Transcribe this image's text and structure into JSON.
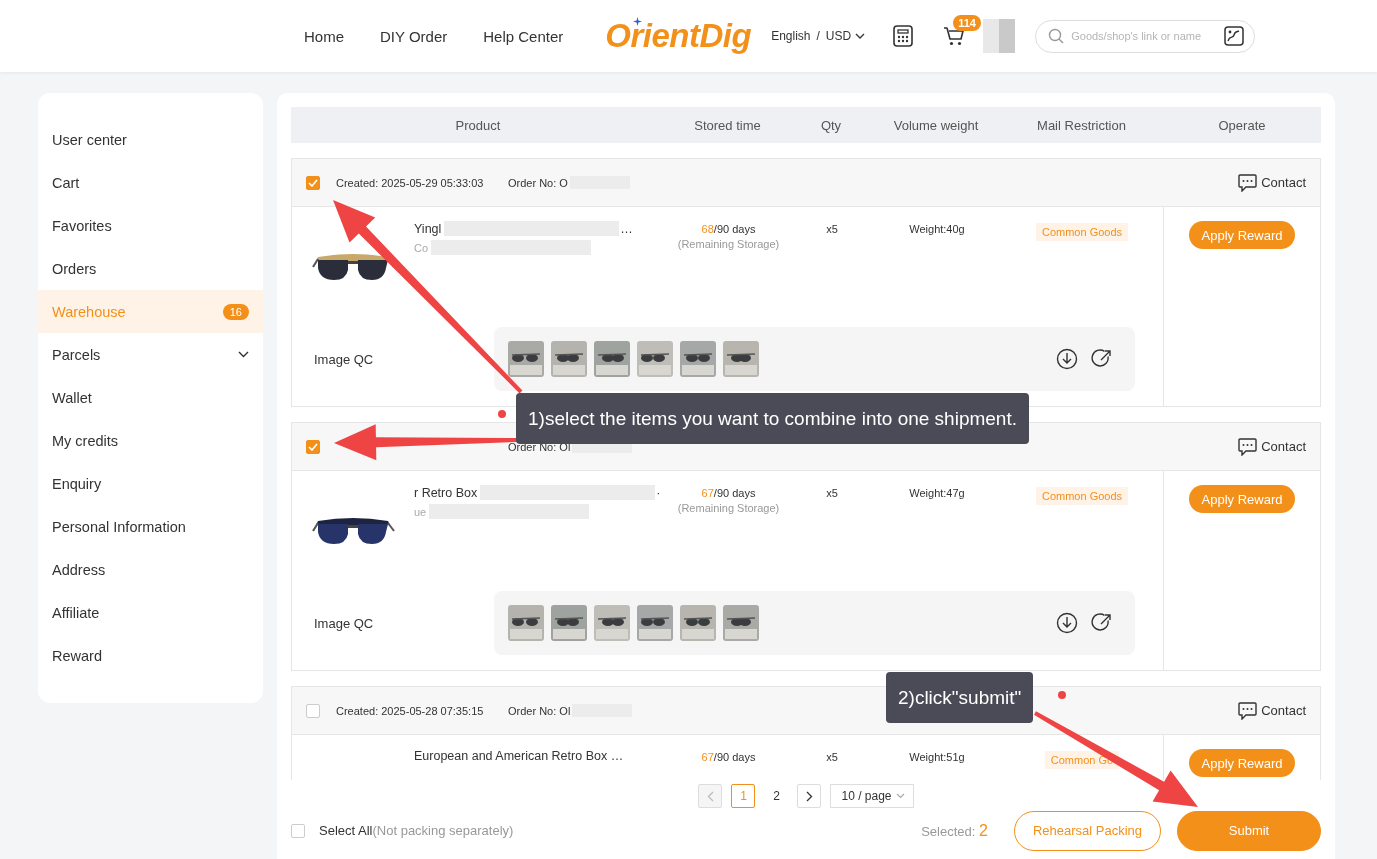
{
  "header": {
    "nav": [
      {
        "label": "Home"
      },
      {
        "label": "DIY Order"
      },
      {
        "label": "Help Center"
      }
    ],
    "logo": "OrientDig",
    "language": "English",
    "separator": "/",
    "currency": "USD",
    "cart_count": "114",
    "search": {
      "placeholder": "Goods/shop's link or name"
    }
  },
  "sidebar": {
    "items": [
      {
        "label": "User center",
        "selected": false
      },
      {
        "label": "Cart",
        "selected": false
      },
      {
        "label": "Favorites",
        "selected": false
      },
      {
        "label": "Orders",
        "selected": false
      },
      {
        "label": "Warehouse",
        "selected": true,
        "badge": "16"
      },
      {
        "label": "Parcels",
        "selected": false,
        "expandable": true
      },
      {
        "label": "Wallet",
        "selected": false
      },
      {
        "label": "My credits",
        "selected": false
      },
      {
        "label": "Enquiry",
        "selected": false
      },
      {
        "label": "Personal Information",
        "selected": false
      },
      {
        "label": "Address",
        "selected": false
      },
      {
        "label": "Affiliate",
        "selected": false
      },
      {
        "label": "Reward",
        "selected": false
      }
    ]
  },
  "table": {
    "columns": [
      "Product",
      "Stored time",
      "Qty",
      "Volume weight",
      "Mail Restriction",
      "Operate"
    ]
  },
  "orders": [
    {
      "checked": true,
      "created": "Created: 2025-05-29 05:33:03",
      "order_no": "Order No: O",
      "contact": "Contact",
      "product": {
        "name": "Yingl",
        "name_tail": "…",
        "spec": "Co"
      },
      "storage": {
        "used": "68",
        "total": "/90 days",
        "note": "(Remaining Storage)"
      },
      "qty": "x5",
      "weight": "Weight:40g",
      "restriction": "Common Goods",
      "action": "Apply Reward",
      "qc": {
        "label": "Image QC"
      }
    },
    {
      "checked": true,
      "order_no": "Order No: Ol",
      "contact": "Contact",
      "product": {
        "name": "r Retro Box",
        "name_tail": "·",
        "spec": "ue"
      },
      "storage": {
        "used": "67",
        "total": "/90 days",
        "note": "(Remaining Storage)"
      },
      "qty": "x5",
      "weight": "Weight:47g",
      "restriction": "Common Goods",
      "action": "Apply Reward",
      "qc": {
        "label": "Image QC"
      }
    },
    {
      "checked": false,
      "created": "Created: 2025-05-28 07:35:15",
      "order_no": "Order No: Ol",
      "contact": "Contact",
      "product": {
        "name": "European and American Retro Box …"
      },
      "storage": {
        "used": "67",
        "total": "/90 days"
      },
      "qty": "x5",
      "weight": "Weight:51g",
      "restriction": "Common Go",
      "action": "Apply Reward"
    }
  ],
  "pagination": {
    "pages": [
      {
        "label": "1",
        "selected": true
      },
      {
        "label": "2",
        "selected": false
      }
    ],
    "page_size": "10 / page"
  },
  "footer": {
    "select_all": {
      "checked": false,
      "label": "Select All",
      "note": "(Not packing separately)"
    },
    "selected_label": "Selected:",
    "selected_count": "2",
    "buttons": [
      {
        "kind": "outline",
        "label": "Rehearsal Packing"
      },
      {
        "kind": "primary",
        "label": "Submit"
      }
    ]
  },
  "annotations": [
    {
      "text": "1)select the items you want to combine into one shipment."
    },
    {
      "text": "2)click\"submit\""
    }
  ]
}
